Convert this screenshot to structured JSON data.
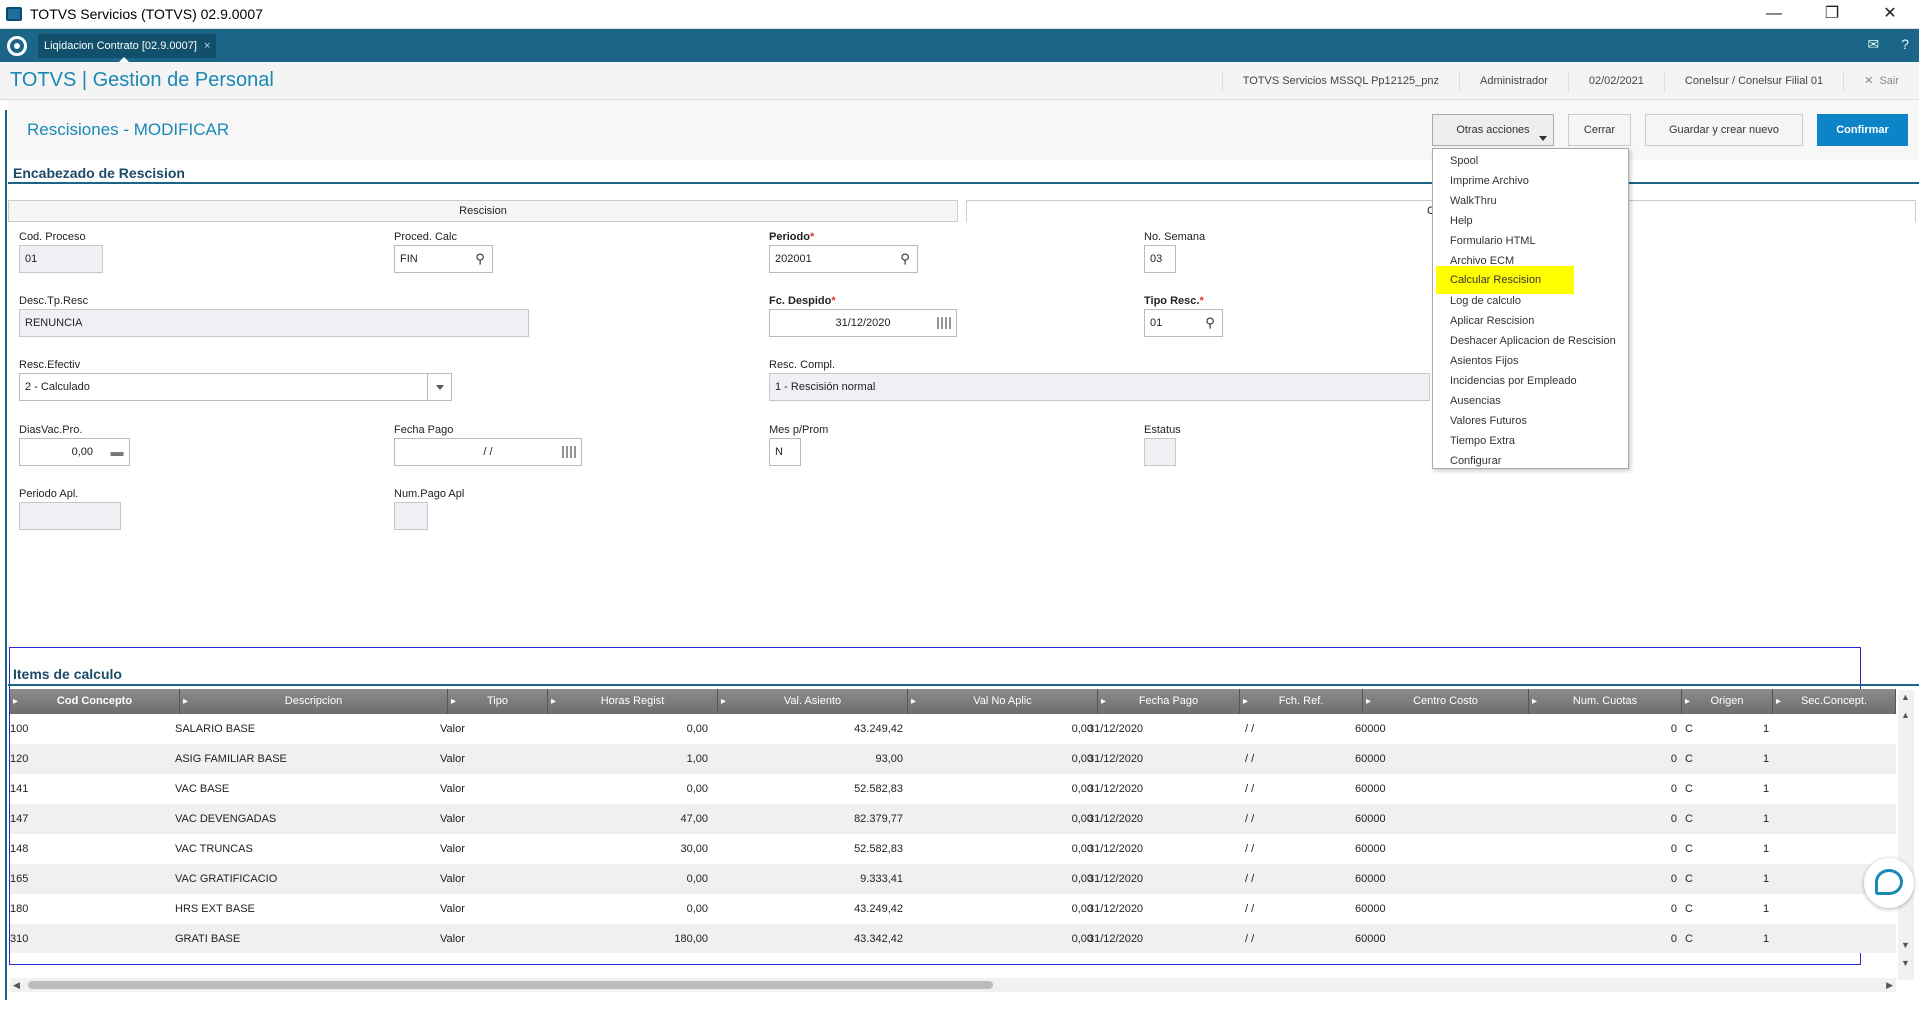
{
  "window": {
    "title": "TOTVS Servicios (TOTVS) 02.9.0007"
  },
  "tab": {
    "label": "Liqidacion Contrato [02.9.0007]",
    "close": "×"
  },
  "header": {
    "brand": "TOTVS | Gestion de Personal",
    "environment": "TOTVS Servicios MSSQL Pp12125_pnz",
    "user": "Administrador",
    "date": "02/02/2021",
    "branch": "Conelsur / Conelsur Filial 01",
    "exit": "Sair"
  },
  "page": {
    "title": "Rescisiones - MODIFICAR",
    "buttons": {
      "otras": "Otras acciones",
      "cerrar": "Cerrar",
      "guardar": "Guardar y crear nuevo",
      "confirmar": "Confirmar"
    }
  },
  "section": {
    "title": "Encabezado de Rescision",
    "folder1": "Rescision",
    "folder2": "C"
  },
  "fields": {
    "cod_proceso": {
      "label": "Cod. Proceso",
      "value": "01"
    },
    "proced_calc": {
      "label": "Proced. Calc",
      "value": "FIN"
    },
    "periodo": {
      "label": "Periodo",
      "value": "202001"
    },
    "no_semana": {
      "label": "No. Semana",
      "value": "03"
    },
    "desc_tp_resc": {
      "label": "Desc.Tp.Resc",
      "value": "RENUNCIA"
    },
    "fc_despido": {
      "label": "Fc. Despido",
      "value": "31/12/2020"
    },
    "tipo_resc": {
      "label": "Tipo Resc.",
      "value": "01"
    },
    "resc_efectiv": {
      "label": "Resc.Efectiv",
      "value": "2 - Calculado"
    },
    "resc_compl": {
      "label": "Resc. Compl.",
      "value": "1 - Rescisión normal"
    },
    "dias_vac_pro": {
      "label": "DiasVac.Pro.",
      "value": "0,00"
    },
    "fecha_pago": {
      "label": "Fecha Pago",
      "value": "/ /"
    },
    "mes_prom": {
      "label": "Mes p/Prom",
      "value": "N"
    },
    "estatus": {
      "label": "Estatus",
      "value": ""
    },
    "periodo_apl": {
      "label": "Periodo Apl.",
      "value": ""
    },
    "num_pago_apl": {
      "label": "Num.Pago Apl",
      "value": ""
    },
    "required_mark": "*"
  },
  "menu": {
    "items": [
      "Spool",
      "Imprime Archivo",
      "WalkThru",
      "Help",
      "Formulario HTML",
      "Archivo ECM",
      "Calcular Rescision",
      "Log de calculo",
      "Aplicar Rescision",
      "Deshacer Aplicacion de Rescision",
      "Asientos Fijos",
      "Incidencias por Empleado",
      "Ausencias",
      "Valores Futuros",
      "Tiempo Extra",
      "Configurar"
    ],
    "highlighted": "Calcular Rescision"
  },
  "items": {
    "title": "Items de calculo",
    "columns": [
      "Cod Concepto",
      "Descripcion",
      "Tipo",
      "Horas Regist",
      "Val. Asiento",
      "Val No Aplic",
      "Fecha Pago",
      "Fch. Ref.",
      "Centro Costo",
      "Num. Cuotas",
      "Origen",
      "Sec.Concept."
    ],
    "rows": [
      [
        "100",
        "SALARIO BASE",
        "Valor",
        "0,00",
        "43.249,42",
        "0,00",
        "31/12/2020",
        "/ /",
        "60000",
        "0",
        "C",
        "1"
      ],
      [
        "120",
        "ASIG FAMILIAR BASE",
        "Valor",
        "1,00",
        "93,00",
        "0,00",
        "31/12/2020",
        "/ /",
        "60000",
        "0",
        "C",
        "1"
      ],
      [
        "141",
        "VAC BASE",
        "Valor",
        "0,00",
        "52.582,83",
        "0,00",
        "31/12/2020",
        "/ /",
        "60000",
        "0",
        "C",
        "1"
      ],
      [
        "147",
        "VAC DEVENGADAS",
        "Valor",
        "47,00",
        "82.379,77",
        "0,00",
        "31/12/2020",
        "/ /",
        "60000",
        "0",
        "C",
        "1"
      ],
      [
        "148",
        "VAC TRUNCAS",
        "Valor",
        "30,00",
        "52.582,83",
        "0,00",
        "31/12/2020",
        "/ /",
        "60000",
        "0",
        "C",
        "1"
      ],
      [
        "165",
        "VAC GRATIFICACIO",
        "Valor",
        "0,00",
        "9.333,41",
        "0,00",
        "31/12/2020",
        "/ /",
        "60000",
        "0",
        "C",
        "1"
      ],
      [
        "180",
        "HRS EXT BASE",
        "Valor",
        "0,00",
        "43.249,42",
        "0,00",
        "31/12/2020",
        "/ /",
        "60000",
        "0",
        "C",
        "1"
      ],
      [
        "310",
        "GRATI BASE",
        "Valor",
        "180,00",
        "43.342,42",
        "0,00",
        "31/12/2020",
        "/ /",
        "60000",
        "0",
        "C",
        "1"
      ]
    ]
  },
  "colors": {
    "brand": "#1a88b5",
    "topbar": "#1b6688",
    "confirm": "#0c84c7",
    "highlight": "#ffff00"
  }
}
